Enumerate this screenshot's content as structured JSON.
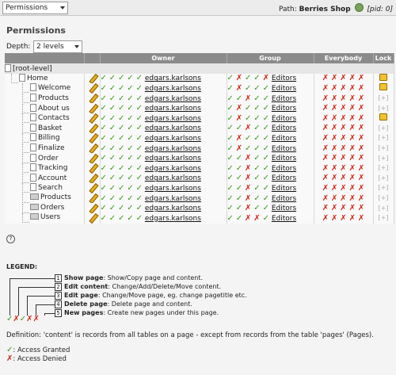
{
  "topbar": {
    "function_select": "Permissions",
    "path_label": "Path:",
    "path_value": "Berries Shop",
    "pid": "[pid: 0]"
  },
  "page_title": "Permissions",
  "depth": {
    "label": "Depth:",
    "value": "2 levels"
  },
  "columns": {
    "owner": "Owner",
    "group": "Group",
    "everybody": "Everybody",
    "lock": "Lock"
  },
  "root_label": "[root-level]",
  "rows": [
    {
      "title": "Home",
      "owner": "edgars.karlsons",
      "group": "Editors",
      "icon": "page"
    },
    {
      "title": "Welcome",
      "owner": "edgars.karlsons",
      "group": "Editors",
      "icon": "page"
    },
    {
      "title": "Products",
      "owner": "edgars.karlsons",
      "group": "Editors",
      "icon": "page"
    },
    {
      "title": "About us",
      "owner": "edgars.karlsons",
      "group": "Editors",
      "icon": "page"
    },
    {
      "title": "Contacts",
      "owner": "edgars.karlsons",
      "group": "Editors",
      "icon": "page"
    },
    {
      "title": "Basket",
      "owner": "edgars.karlsons",
      "group": "Editors",
      "icon": "page"
    },
    {
      "title": "Billing",
      "owner": "edgars.karlsons",
      "group": "Editors",
      "icon": "page"
    },
    {
      "title": "Finalize",
      "owner": "edgars.karlsons",
      "group": "Editors",
      "icon": "page"
    },
    {
      "title": "Order",
      "owner": "edgars.karlsons",
      "group": "Editors",
      "icon": "page"
    },
    {
      "title": "Tracking",
      "owner": "edgars.karlsons",
      "group": "Editors",
      "icon": "page"
    },
    {
      "title": "Account",
      "owner": "edgars.karlsons",
      "group": "Editors",
      "icon": "page"
    },
    {
      "title": "Search",
      "owner": "edgars.karlsons",
      "group": "Editors",
      "icon": "page"
    },
    {
      "title": "Products",
      "owner": "edgars.karlsons",
      "group": "Editors",
      "icon": "folder"
    },
    {
      "title": "Orders",
      "owner": "edgars.karlsons",
      "group": "Editors",
      "icon": "folder"
    },
    {
      "title": "Users",
      "owner": "edgars.karlsons",
      "group": "Editors",
      "icon": "folder"
    }
  ],
  "legend": {
    "title": "LEGEND:",
    "items": [
      {
        "num": "1",
        "name": "Show page",
        "desc": ": Show/Copy page and content."
      },
      {
        "num": "2",
        "name": "Edit content",
        "desc": ": Change/Add/Delete/Move content."
      },
      {
        "num": "3",
        "name": "Edit page",
        "desc": ": Change/Move page, eg. change pagetitle etc."
      },
      {
        "num": "4",
        "name": "Delete page",
        "desc": ": Delete page and content."
      },
      {
        "num": "5",
        "name": "New pages",
        "desc": ": Create new pages under this page."
      }
    ],
    "definition": "Definition: 'content' is records from all tables on a page - except from records from the table 'pages' (Pages).",
    "granted": ": Access Granted",
    "denied": ": Access Denied"
  }
}
